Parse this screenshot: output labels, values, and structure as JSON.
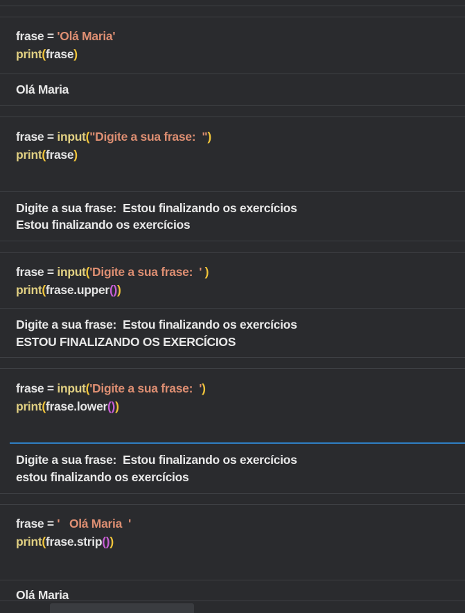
{
  "cells": [
    {
      "code": [
        [
          [
            "v",
            "frase"
          ],
          [
            "p",
            " = "
          ],
          [
            "s",
            "'Olá Maria'"
          ]
        ],
        [
          [
            "fn",
            "print"
          ],
          [
            "par",
            "("
          ],
          [
            "v",
            "frase"
          ],
          [
            "par",
            ")"
          ]
        ]
      ],
      "output": [
        "Olá Maria"
      ]
    },
    {
      "code": [
        [
          [
            "v",
            "frase"
          ],
          [
            "p",
            " = "
          ],
          [
            "fn",
            "input"
          ],
          [
            "par",
            "("
          ],
          [
            "s",
            "\"Digite a sua frase:  \""
          ],
          [
            "par",
            ")"
          ]
        ],
        [
          [
            "fn",
            "print"
          ],
          [
            "par",
            "("
          ],
          [
            "v",
            "frase"
          ],
          [
            "par",
            ")"
          ]
        ]
      ],
      "output": [
        "Digite a sua frase:  Estou finalizando os exercícios",
        "Estou finalizando os exercícios"
      ]
    },
    {
      "code": [
        [
          [
            "v",
            "frase"
          ],
          [
            "p",
            " = "
          ],
          [
            "fn",
            "input"
          ],
          [
            "par",
            "("
          ],
          [
            "s",
            "'Digite a sua frase:  '"
          ],
          [
            "par",
            " )"
          ]
        ],
        [
          [
            "fn",
            "print"
          ],
          [
            "par",
            "("
          ],
          [
            "v",
            "frase.upper"
          ],
          [
            "par2",
            "()"
          ],
          [
            "par",
            ")"
          ]
        ]
      ],
      "output": [
        "Digite a sua frase:  Estou finalizando os exercícios",
        "ESTOU FINALIZANDO OS EXERCÍCIOS"
      ]
    },
    {
      "code": [
        [
          [
            "v",
            "frase"
          ],
          [
            "p",
            " = "
          ],
          [
            "fn",
            "input"
          ],
          [
            "par",
            "("
          ],
          [
            "s",
            "'Digite a sua frase:  '"
          ],
          [
            "par",
            ")"
          ]
        ],
        [
          [
            "fn",
            "print"
          ],
          [
            "par",
            "("
          ],
          [
            "v",
            "frase.lower"
          ],
          [
            "par2",
            "()"
          ],
          [
            "par",
            ")"
          ]
        ]
      ],
      "output": [
        "Digite a sua frase:  Estou finalizando os exercícios",
        "estou finalizando os exercícios"
      ]
    },
    {
      "code": [
        [
          [
            "v",
            "frase"
          ],
          [
            "p",
            " = "
          ],
          [
            "s",
            "'   Olá Maria  '"
          ]
        ],
        [
          [
            "fn",
            "print"
          ],
          [
            "par",
            "("
          ],
          [
            "v",
            "frase.strip"
          ],
          [
            "par2",
            "()"
          ],
          [
            "par",
            ")"
          ]
        ]
      ],
      "output": [
        "Olá Maria"
      ]
    }
  ],
  "colors": {
    "background": "#2a2b2e",
    "separator": "#3e4044",
    "active_cell_border": "#2f7fc4",
    "string": "#dd8e72",
    "function": "#e0cf82",
    "paren": "#f0c43a",
    "inner_paren": "#c65fd4",
    "text": "#e4e4e4"
  }
}
